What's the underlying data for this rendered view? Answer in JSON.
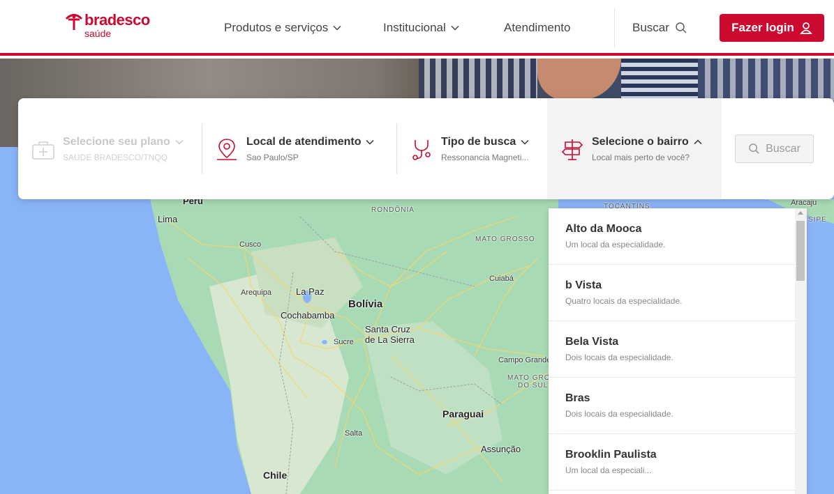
{
  "header": {
    "logo_brand": "bradesco",
    "logo_sub": "saúde",
    "nav": [
      "Produtos e serviços",
      "Institucional",
      "Atendimento"
    ],
    "search_label": "Buscar",
    "login_label": "Fazer login"
  },
  "search_card": {
    "plan": {
      "title": "Selecione seu plano",
      "subtitle": "SAUDE BRADESCO/TNQQ"
    },
    "location": {
      "title": "Local de atendimento",
      "subtitle": "Sao Paulo/SP"
    },
    "type": {
      "title": "Tipo de busca",
      "subtitle": "Ressonancia Magneti..."
    },
    "neighborhood": {
      "title": "Selecione o bairro",
      "subtitle": "Local mais perto de você?"
    },
    "button_label": "Buscar"
  },
  "dropdown": {
    "items": [
      {
        "name": "Alto da Mooca",
        "desc": "Um local da especialidade."
      },
      {
        "name": "b Vista",
        "desc": "Quatro locais da especialidade."
      },
      {
        "name": "Bela Vista",
        "desc": "Dois locais da especialidade."
      },
      {
        "name": "Bras",
        "desc": "Dois locais da especialidade."
      },
      {
        "name": "Brooklin Paulista",
        "desc": "Um local da especiali..."
      }
    ]
  },
  "map": {
    "labels": {
      "peru": "Peru",
      "lima": "Lima",
      "cusco": "Cusco",
      "arequipa": "Arequipa",
      "lapaz": "La Paz",
      "bolivia": "Bolívia",
      "cochabamba": "Cochabamba",
      "santacruz1": "Santa Cruz",
      "santacruz2": "de La Sierra",
      "sucre": "Sucre",
      "rondonia": "RONDÔNIA",
      "matogrosso": "MATO GROSSO",
      "cuiaba": "Cuiabá",
      "campogrande": "Campo Grande",
      "mgsul1": "MATO GROSSO",
      "mgsul2": "DO SUL",
      "paraguai": "Paraguai",
      "assuncao": "Assunção",
      "salta": "Salta",
      "chile": "Chile",
      "tocantins": "TOCANTINS",
      "aracaju": "Aracaju",
      "sipe": "SIPE"
    }
  },
  "colors": {
    "brand": "#cc092f",
    "water": "#8ab4f8",
    "land": "#a8dab5"
  }
}
